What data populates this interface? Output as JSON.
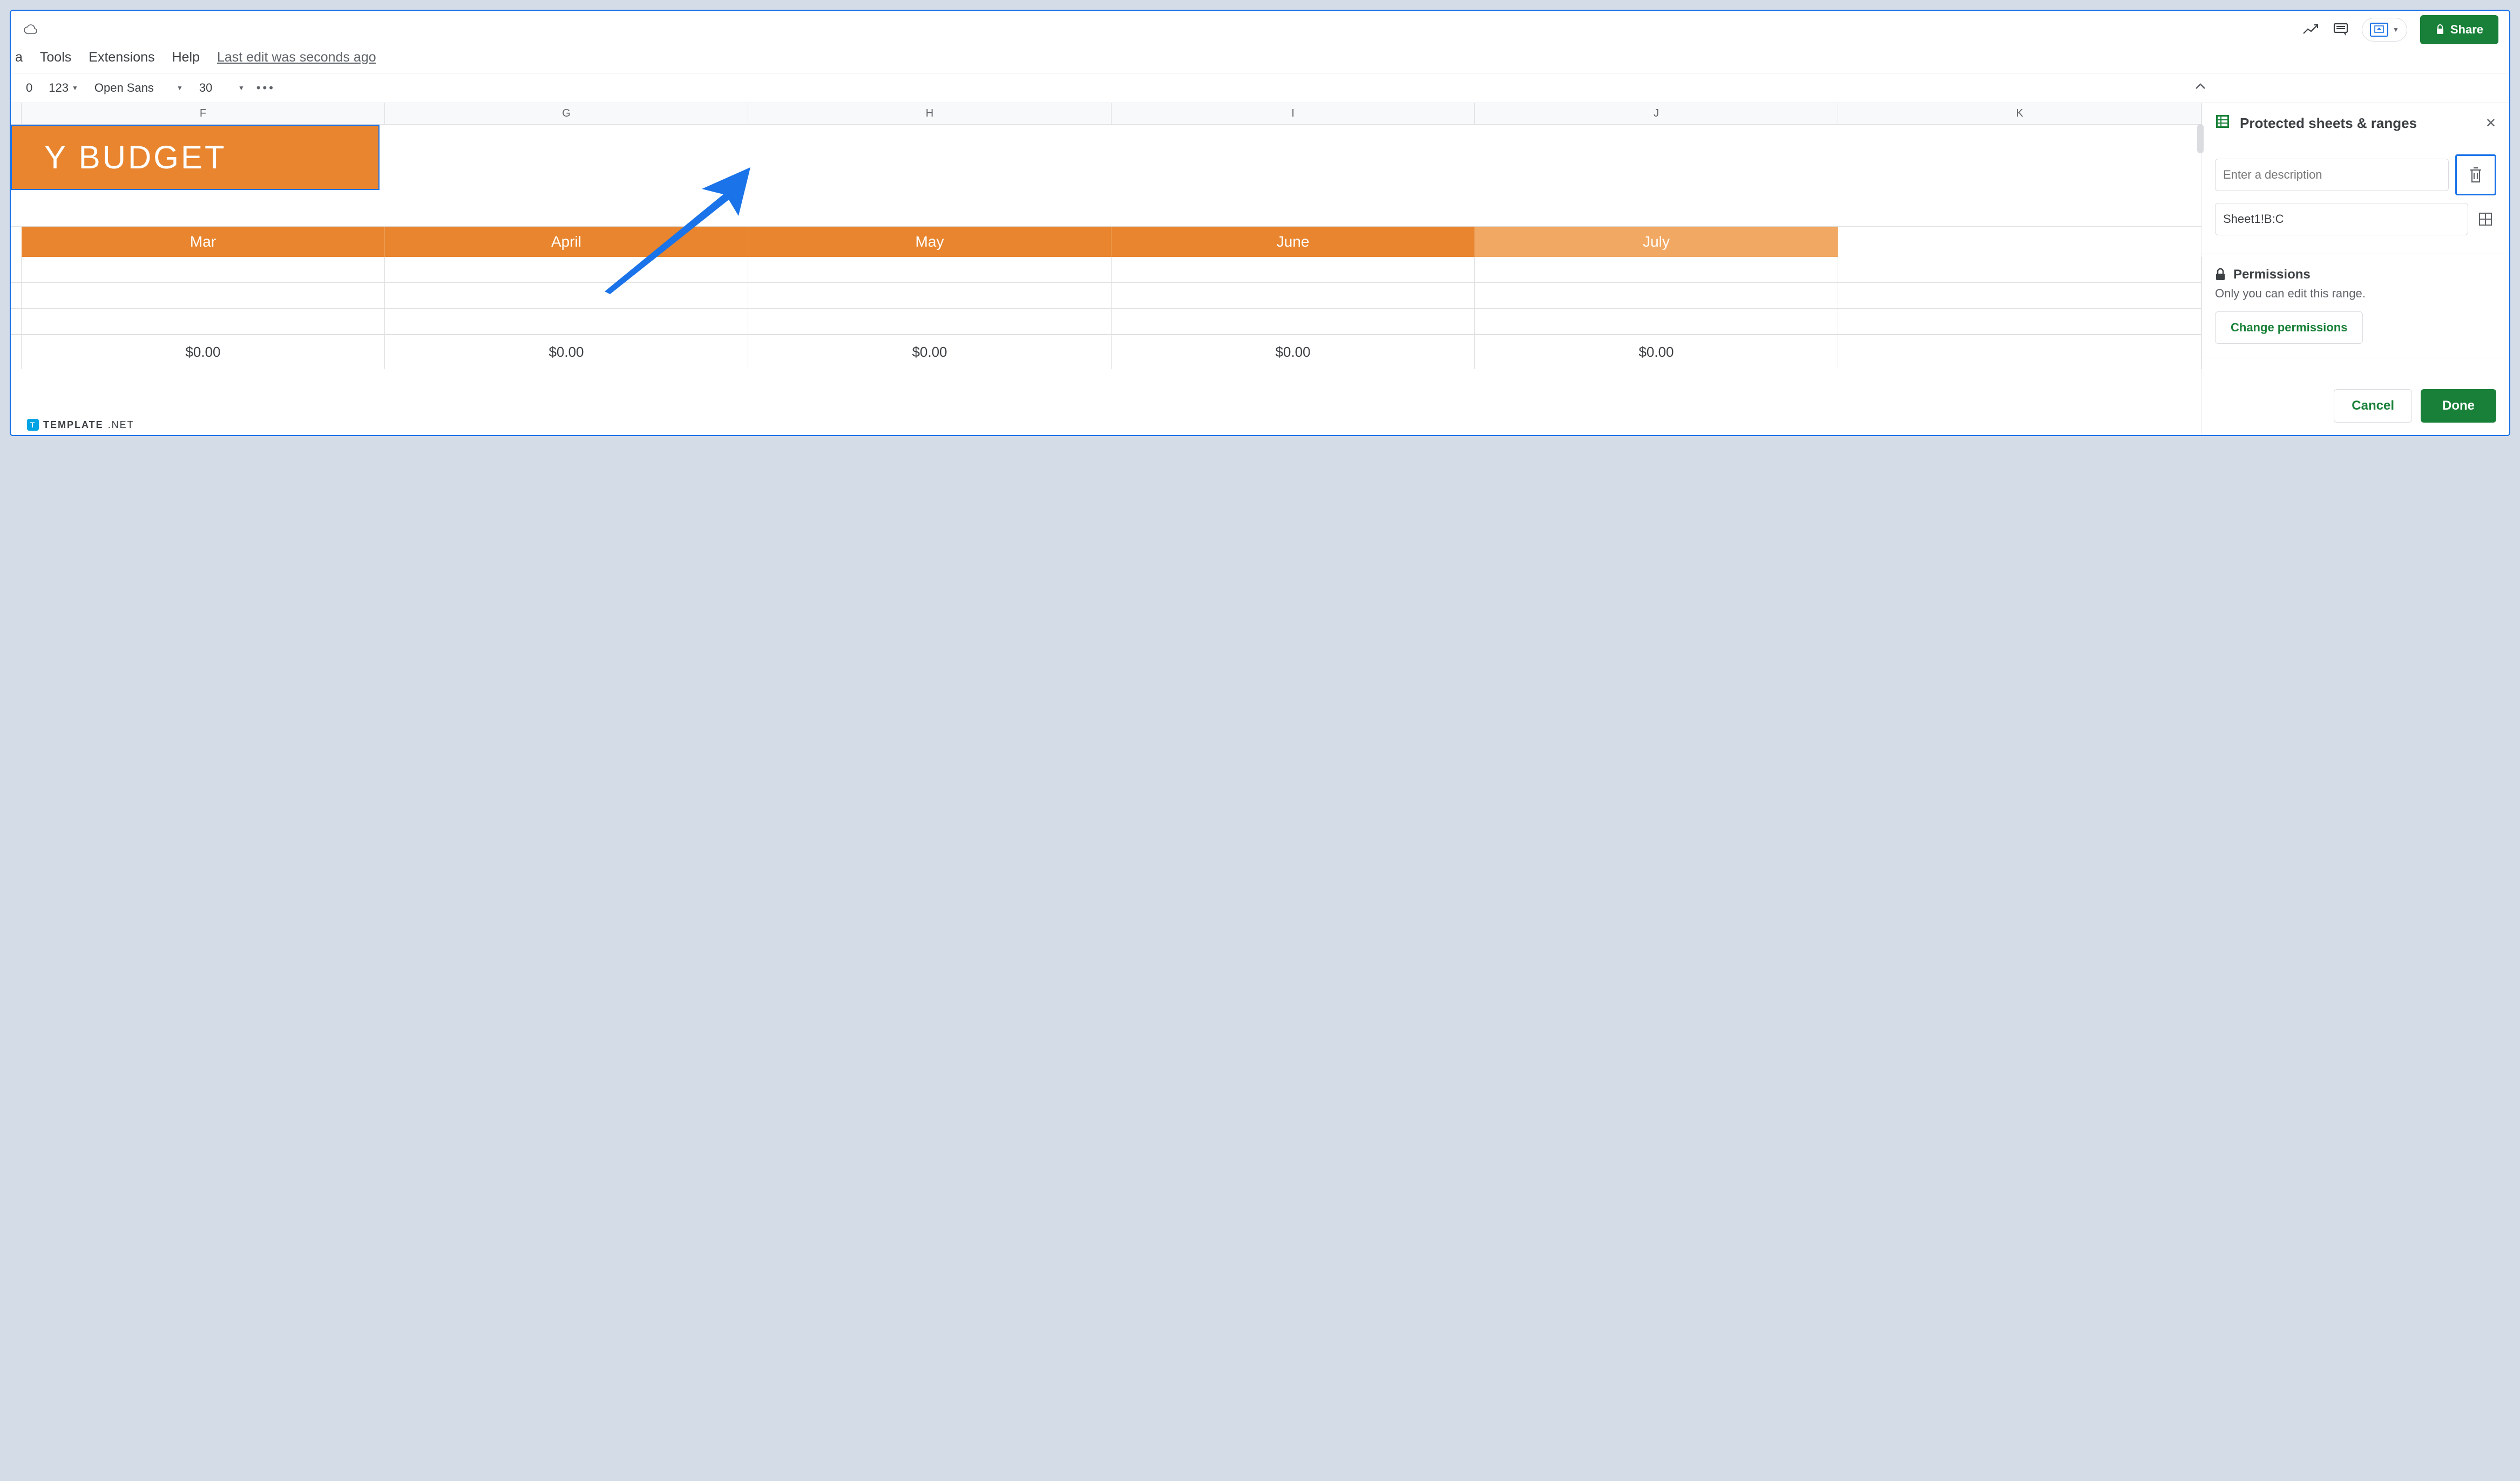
{
  "menubar": {
    "partial": "a",
    "tools": "Tools",
    "extensions": "Extensions",
    "help": "Help",
    "last_edit": "Last edit was seconds ago"
  },
  "toolbar": {
    "partial_num": "0",
    "number_format": "123",
    "font": "Open Sans",
    "font_size": "30"
  },
  "header": {
    "share_label": "Share"
  },
  "sheet": {
    "columns": [
      "F",
      "G",
      "H",
      "I",
      "J",
      "K"
    ],
    "banner": "Y BUDGET",
    "months": [
      "Mar",
      "April",
      "May",
      "June",
      "July"
    ],
    "values": [
      "$0.00",
      "$0.00",
      "$0.00",
      "$0.00",
      "$0.00"
    ]
  },
  "sidebar": {
    "title": "Protected sheets & ranges",
    "desc_placeholder": "Enter a description",
    "range_value": "Sheet1!B:C",
    "permissions_label": "Permissions",
    "permissions_desc": "Only you can edit this range.",
    "change_label": "Change permissions",
    "cancel_label": "Cancel",
    "done_label": "Done"
  },
  "watermark": {
    "brand": "TEMPLATE",
    "tld": ".NET"
  }
}
